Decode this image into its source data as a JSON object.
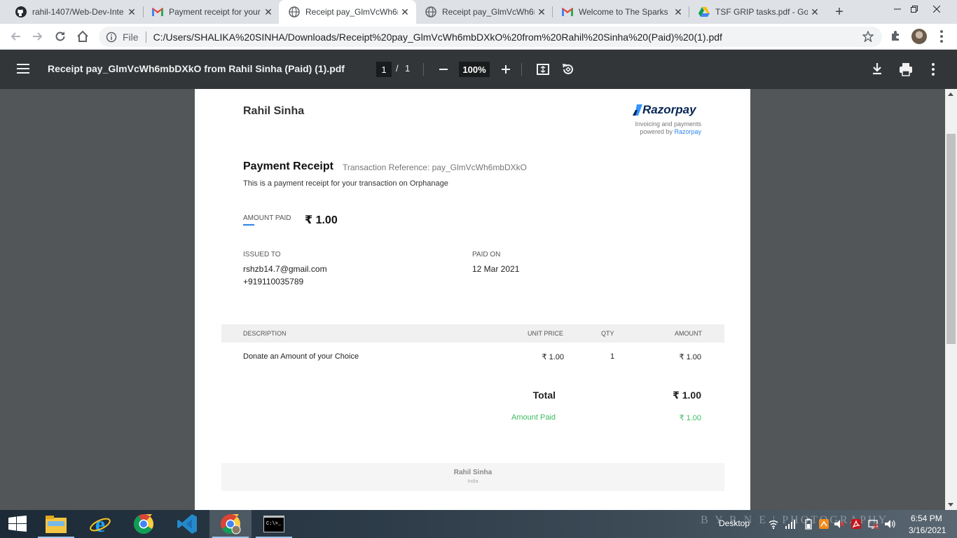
{
  "browser": {
    "tabs": [
      {
        "title": "rahil-1407/Web-Dev-Inte",
        "favicon": "github-icon",
        "active": false
      },
      {
        "title": "Payment receipt for your",
        "favicon": "gmail-icon",
        "active": false
      },
      {
        "title": "Receipt pay_GlmVcWh6r",
        "favicon": "globe-icon",
        "active": true
      },
      {
        "title": "Receipt pay_GlmVcWh6r",
        "favicon": "globe-icon",
        "active": false
      },
      {
        "title": "Welcome to The Sparks",
        "favicon": "gmail-icon",
        "active": false
      },
      {
        "title": "TSF GRIP tasks.pdf - Goo",
        "favicon": "google-drive-icon",
        "active": false
      }
    ],
    "omnibox": {
      "scheme_label": "File",
      "url": "C:/Users/SHALIKA%20SINHA/Downloads/Receipt%20pay_GlmVcWh6mbDXkO%20from%20Rahil%20Sinha%20(Paid)%20(1).pdf"
    }
  },
  "pdf_toolbar": {
    "title": "Receipt pay_GlmVcWh6mbDXkO from Rahil Sinha (Paid) (1).pdf",
    "current_page": "1",
    "separator": "/",
    "total_pages": "1",
    "zoom": "100%"
  },
  "receipt": {
    "merchant_name": "Rahil Sinha",
    "logo_text": "Razorpay",
    "tagline_1": "Invoicing and payments",
    "tagline_2_prefix": "powered by",
    "tagline_2_link": "Razorpay",
    "heading": "Payment Receipt",
    "transaction_ref": "Transaction Reference: pay_GlmVcWh6mbDXkO",
    "subheading": "This is a payment receipt for your transaction on Orphanage",
    "amount_paid_label": "AMOUNT PAID",
    "amount_paid_value": "₹ 1.00",
    "issued_to_label": "ISSUED TO",
    "issued_to_email": "rshzb14.7@gmail.com",
    "issued_to_phone": "+919110035789",
    "paid_on_label": "PAID ON",
    "paid_on_date": "12 Mar 2021",
    "table": {
      "headers": {
        "description": "DESCRIPTION",
        "unit_price": "UNIT PRICE",
        "qty": "QTY",
        "amount": "AMOUNT"
      },
      "rows": [
        {
          "description": "Donate an Amount of your Choice",
          "unit_price": "₹ 1.00",
          "qty": "1",
          "amount": "₹ 1.00"
        }
      ]
    },
    "total_label": "Total",
    "total_value": "₹ 1.00",
    "paid_row_label": "Amount Paid",
    "paid_row_value": "₹ 1.00",
    "footer_name": "Rahil Sinha",
    "footer_country": "India"
  },
  "taskbar": {
    "desktop_label": "Desktop",
    "wallpaper_watermark": "B Y R N E | PHOTOGRAPHY",
    "time": "6:54 PM",
    "date": "3/16/2021"
  },
  "colors": {
    "pdf_toolbar_bg": "#323639",
    "viewer_bg": "#525659",
    "accent_blue": "#2b83ea",
    "paid_green": "#3dbb60",
    "razorpay_navy": "#072654"
  }
}
